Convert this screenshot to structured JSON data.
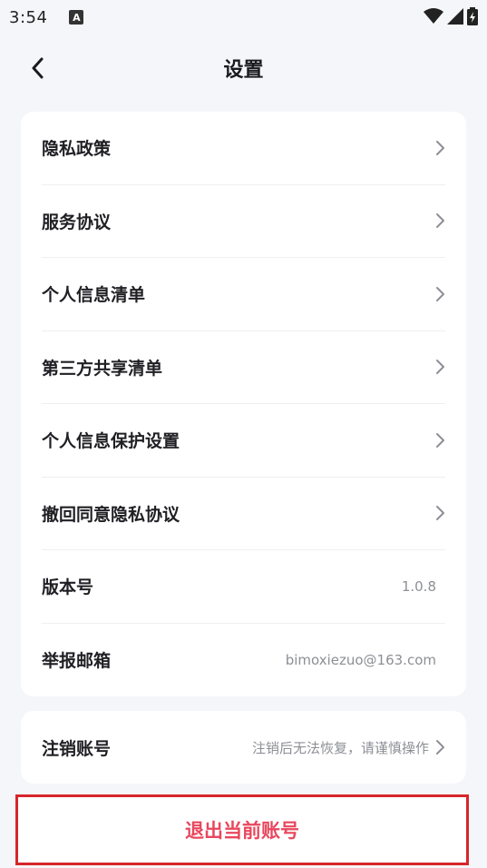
{
  "status_bar": {
    "time": "3:54",
    "notif_icon": "A"
  },
  "header": {
    "title": "设置"
  },
  "settings": [
    {
      "label": "隐私政策",
      "value": "",
      "chevron": true
    },
    {
      "label": "服务协议",
      "value": "",
      "chevron": true
    },
    {
      "label": "个人信息清单",
      "value": "",
      "chevron": true
    },
    {
      "label": "第三方共享清单",
      "value": "",
      "chevron": true
    },
    {
      "label": "个人信息保护设置",
      "value": "",
      "chevron": true
    },
    {
      "label": "撤回同意隐私协议",
      "value": "",
      "chevron": true
    },
    {
      "label": "版本号",
      "value": "1.0.8",
      "chevron": false
    },
    {
      "label": "举报邮箱",
      "value": "bimoxiezuo@163.com",
      "chevron": false
    }
  ],
  "cancel_account": {
    "label": "注销账号",
    "hint": "注销后无法恢复，请谨慎操作"
  },
  "logout": {
    "label": "退出当前账号"
  },
  "colors": {
    "accent_red": "#e8475d",
    "background": "#f5f6fa",
    "highlight_border": "#d6262b"
  }
}
